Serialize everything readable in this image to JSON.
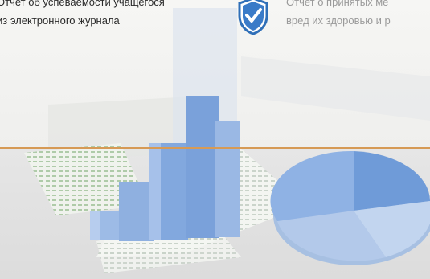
{
  "cards": [
    {
      "icon": "document-icon",
      "lines": [
        "Отчет об успеваемости учащегося",
        "из электронного журнала"
      ]
    },
    {
      "icon": "shield-check-icon",
      "lines": [
        "Отчет о принятых ме",
        "вред их здоровью и р"
      ]
    }
  ],
  "colors": {
    "divider": "#d69a55",
    "shield": "#2f6fb8",
    "chart": "#8fb2e4"
  }
}
